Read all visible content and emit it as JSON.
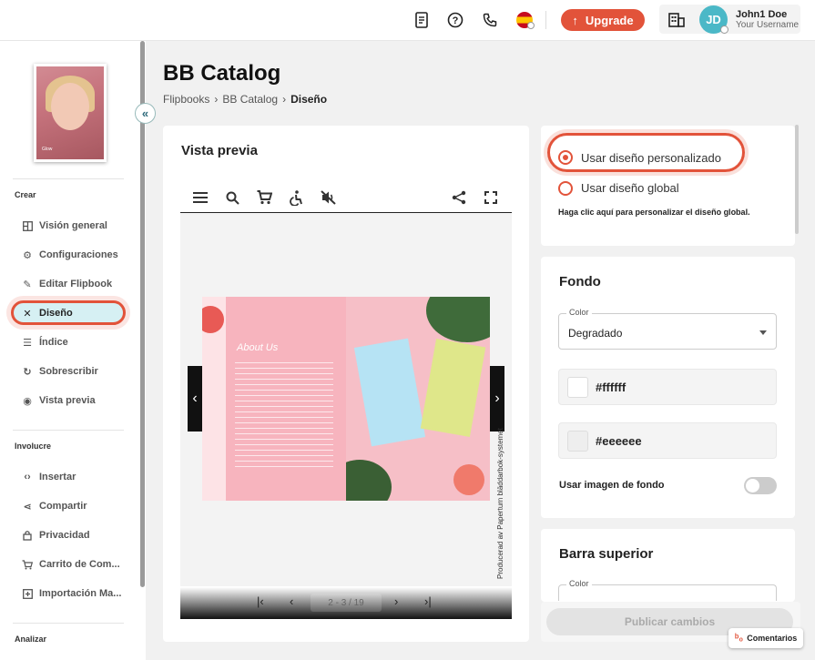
{
  "topbar": {
    "upgrade_label": "Upgrade",
    "user": {
      "initials": "JD",
      "name": "John1 Doe",
      "username": "Your Username"
    }
  },
  "sidebar": {
    "collapse_glyph": "«",
    "thumbnail_text": "Glow",
    "sections": [
      {
        "title": "Crear"
      },
      {
        "title": "Involucre"
      },
      {
        "title": "Analizar"
      }
    ],
    "items": [
      {
        "label": "Visión general",
        "icon": "overview-icon"
      },
      {
        "label": "Configuraciones",
        "icon": "gear-icon"
      },
      {
        "label": "Editar Flipbook",
        "icon": "pencil-icon"
      },
      {
        "label": "Diseño",
        "icon": "design-icon",
        "active": true
      },
      {
        "label": "Índice",
        "icon": "index-icon"
      },
      {
        "label": "Sobrescribir",
        "icon": "refresh-icon"
      },
      {
        "label": "Vista previa",
        "icon": "eye-icon"
      },
      {
        "label": "Insertar",
        "icon": "code-icon"
      },
      {
        "label": "Compartir",
        "icon": "share-icon"
      },
      {
        "label": "Privacidad",
        "icon": "lock-icon"
      },
      {
        "label": "Carrito de Com...",
        "icon": "cart-icon"
      },
      {
        "label": "Importación Ma...",
        "icon": "import-icon"
      }
    ]
  },
  "page": {
    "title": "BB Catalog",
    "breadcrumb": [
      "Flipbooks",
      "BB Catalog",
      "Diseño"
    ]
  },
  "preview": {
    "heading": "Vista previa",
    "left_page_heading": "About Us",
    "credit": "Producerad av Paperturn bläddarbok-systemet",
    "pager": {
      "first": "|‹",
      "prev": "‹",
      "page": "2 - 3 / 19",
      "next": "›",
      "last": "›|"
    }
  },
  "design_options": {
    "custom_label": "Usar diseño personalizado",
    "global_label": "Usar diseño global",
    "note": "Haga clic aquí para personalizar el diseño global.",
    "selected": "custom"
  },
  "fondo": {
    "heading": "Fondo",
    "color_label": "Color",
    "color_value": "Degradado",
    "color1": "#ffffff",
    "color2": "#eeeeee",
    "bg_image_label": "Usar imagen de fondo",
    "bg_image_on": false
  },
  "barra": {
    "heading": "Barra superior",
    "color_label": "Color"
  },
  "actions": {
    "publish_label": "Publicar cambios",
    "comments_label": "Comentarios"
  },
  "colors": {
    "accent": "#e2533a",
    "teal": "#4bb8c7",
    "active_bg": "#d6f0f3"
  }
}
